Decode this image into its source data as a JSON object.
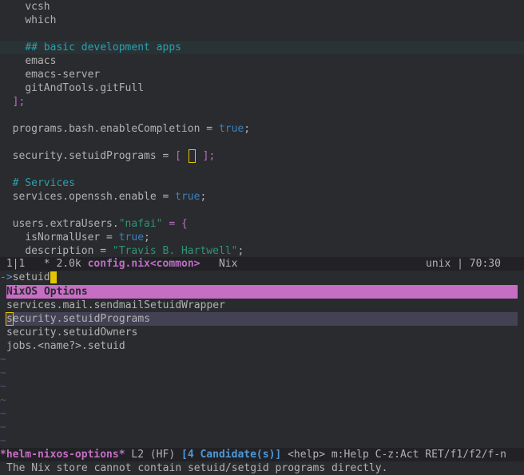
{
  "editor": {
    "lines": [
      {
        "indent": "    ",
        "text": "vcsh"
      },
      {
        "indent": "    ",
        "text": "which"
      },
      {
        "indent": "",
        "text": ""
      },
      {
        "indent": "    ",
        "text": "## basic development apps"
      },
      {
        "indent": "    ",
        "text": "emacs"
      },
      {
        "indent": "    ",
        "text": "emacs-server"
      },
      {
        "indent": "    ",
        "text": "gitAndTools.gitFull"
      },
      {
        "indent": "  ",
        "text": "];"
      },
      {
        "indent": "",
        "text": ""
      },
      {
        "indent": "  ",
        "text": "programs.bash.enableCompletion = ",
        "value": "true",
        "tail": ";"
      },
      {
        "indent": "",
        "text": ""
      },
      {
        "indent": "  ",
        "text": "security.setuidPrograms = ",
        "open": "[",
        "close": "];"
      },
      {
        "indent": "",
        "text": ""
      },
      {
        "indent": "  ",
        "text": "# Services"
      },
      {
        "indent": "  ",
        "text": "services.openssh.enable = ",
        "value": "true",
        "tail": ";"
      },
      {
        "indent": "",
        "text": ""
      },
      {
        "indent": "  ",
        "text": "users.extraUsers.",
        "string": "\"nafai\"",
        "tail": " = {"
      },
      {
        "indent": "    ",
        "text": "isNormalUser = ",
        "value": "true",
        "tail": ";"
      },
      {
        "indent": "    ",
        "text": "description = ",
        "string": "\"Travis B. Hartwell\"",
        "tail": ";"
      }
    ]
  },
  "modeline": {
    "position": "1|1",
    "modified": "* 2.0k",
    "buffer": "config.nix<common>",
    "mode": "Nix",
    "encoding": "unix",
    "cursor": "70:30"
  },
  "helm": {
    "prompt_arrow": "->",
    "query": "setuid",
    "source": "NixOS Options",
    "candidates": [
      "services.mail.sendmailSetuidWrapper",
      "security.setuidPrograms",
      "security.setuidOwners",
      "jobs.<name?>.setuid"
    ],
    "selected_index": 1,
    "tilde": "~",
    "tilde_count": 7
  },
  "helm_modeline": {
    "name": "*helm-nixos-options*",
    "line": "L2",
    "mode": "(HF)",
    "count": "[4 Candidate(s)]",
    "help": "<help> m:Help C-z:Act RET/f1/f2/f-n"
  },
  "echo": "The Nix store cannot contain setuid/setgid programs directly.",
  "colors": {
    "background": "#292b2e",
    "comment": "#2aa1ae",
    "keyword_value": "#3a81c3",
    "string": "#2d9574",
    "accent": "#c56ec3",
    "cursor": "#e3c600"
  }
}
